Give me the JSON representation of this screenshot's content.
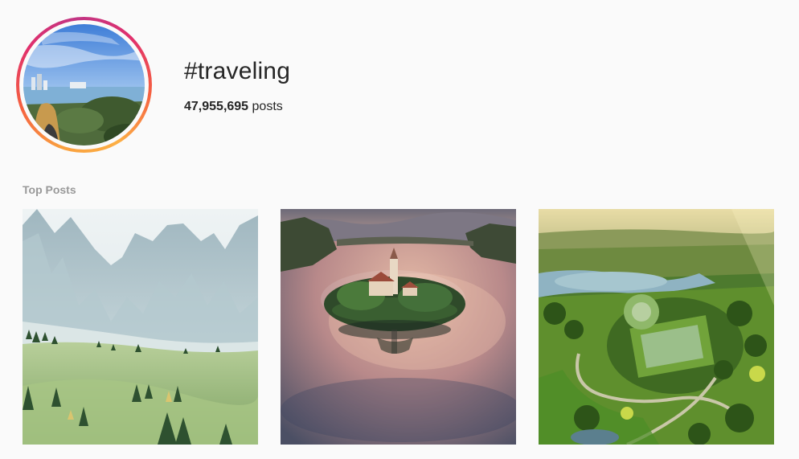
{
  "header": {
    "hashtag": "#traveling",
    "post_count": "47,955,695",
    "post_count_suffix": " posts"
  },
  "sections": {
    "top_posts_label": "Top Posts"
  },
  "top_posts": [
    {
      "subject": "mountain-meadow-photo"
    },
    {
      "subject": "lake-island-church-photo"
    },
    {
      "subject": "garden-aerial-photo"
    }
  ],
  "colors": {
    "background": "#fafafa",
    "text": "#262626",
    "muted": "#999999",
    "story_ring": [
      "#fcaf45",
      "#f56040",
      "#e1306c",
      "#c13584"
    ]
  }
}
